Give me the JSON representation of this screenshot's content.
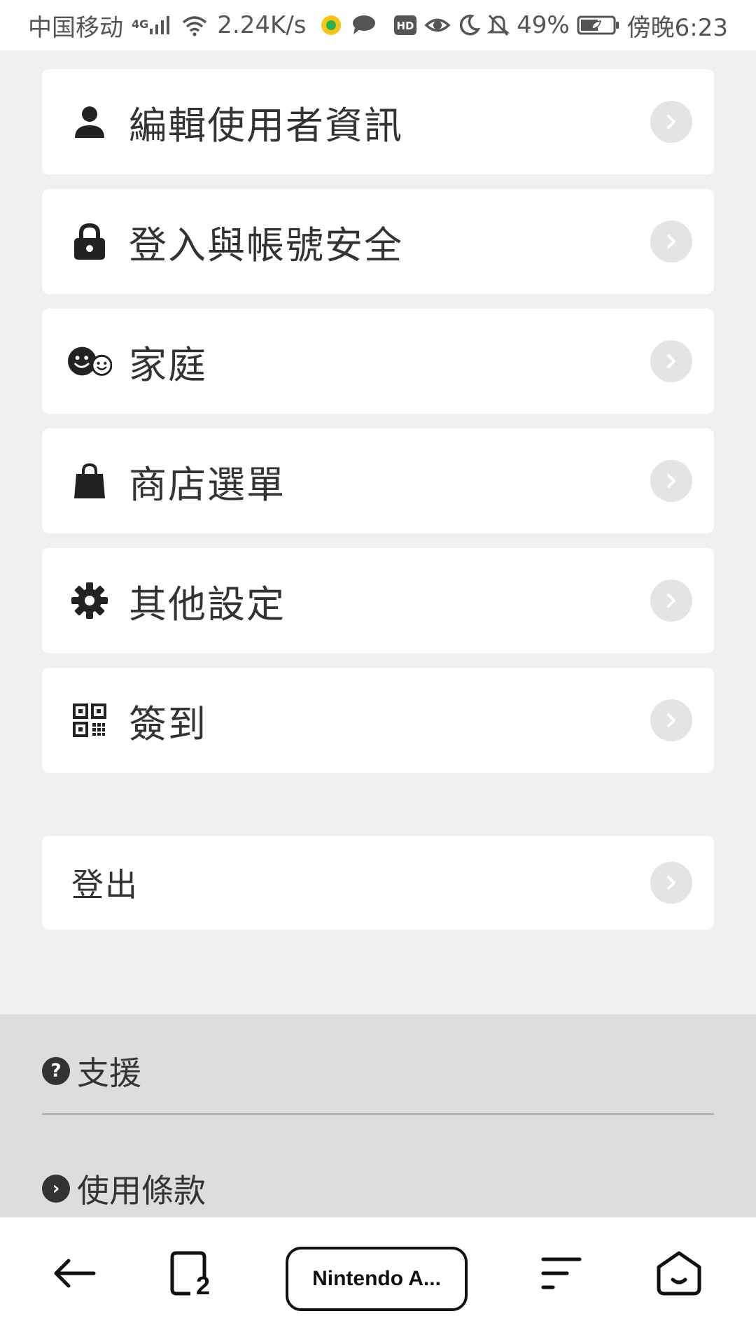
{
  "status_bar": {
    "carrier": "中国移动",
    "network": "4G",
    "speed": "2.24K/s",
    "battery": "49%",
    "time": "傍晚6:23",
    "icons": [
      "signal-icon",
      "wifi-icon",
      "qq-music-icon",
      "chat-bubble-icon",
      "hd-icon",
      "eye-icon",
      "moon-icon",
      "bell-off-icon",
      "battery-icon"
    ]
  },
  "menu": {
    "items": [
      {
        "label": "編輯使用者資訊",
        "icon": "user-icon"
      },
      {
        "label": "登入與帳號安全",
        "icon": "lock-icon"
      },
      {
        "label": "家庭",
        "icon": "family-faces-icon"
      },
      {
        "label": "商店選單",
        "icon": "shopping-bag-icon"
      },
      {
        "label": "其他設定",
        "icon": "gear-icon"
      },
      {
        "label": "簽到",
        "icon": "qr-code-icon"
      }
    ],
    "logout_label": "登出"
  },
  "footer": {
    "support_label": "支援",
    "support_icon_glyph": "?",
    "terms_label": "使用條款",
    "terms_icon_glyph": "›"
  },
  "bottom_nav": {
    "tab_count": "2",
    "tab_title": "Nintendo A..."
  },
  "colors": {
    "page_bg": "#f0f0f0",
    "card_bg": "#ffffff",
    "footer_bg": "#dddddd",
    "chevron_bg": "#e4e4e4",
    "text": "#333333"
  }
}
